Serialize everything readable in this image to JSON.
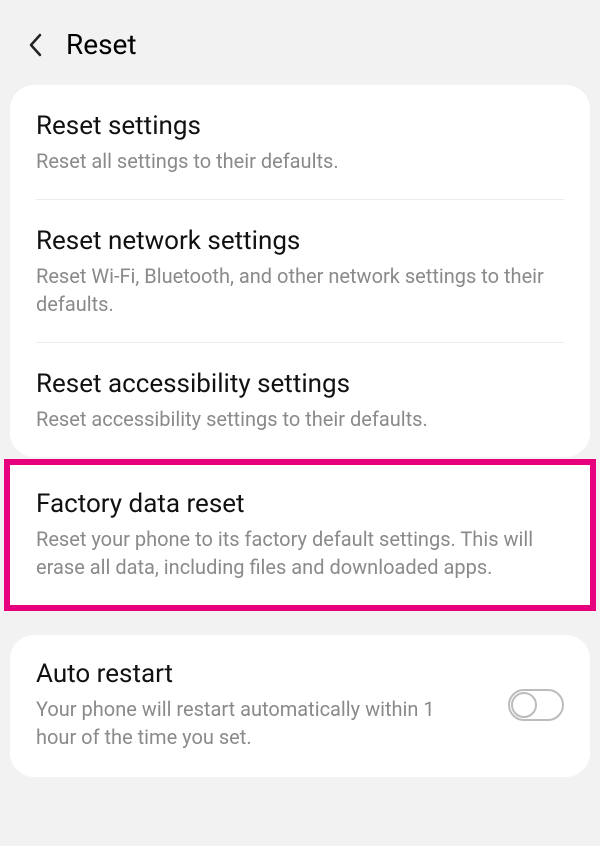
{
  "header": {
    "title": "Reset"
  },
  "items": [
    {
      "title": "Reset settings",
      "desc": "Reset all settings to their defaults."
    },
    {
      "title": "Reset network settings",
      "desc": "Reset Wi-Fi, Bluetooth, and other network settings to their defaults."
    },
    {
      "title": "Reset accessibility settings",
      "desc": "Reset accessibility settings to their defaults."
    },
    {
      "title": "Factory data reset",
      "desc": "Reset your phone to its factory default settings. This will erase all data, including files and downloaded apps."
    }
  ],
  "autoRestart": {
    "title": "Auto restart",
    "desc": "Your phone will restart automatically within 1 hour of the time you set.",
    "enabled": false
  },
  "highlight_color": "#e6007e"
}
